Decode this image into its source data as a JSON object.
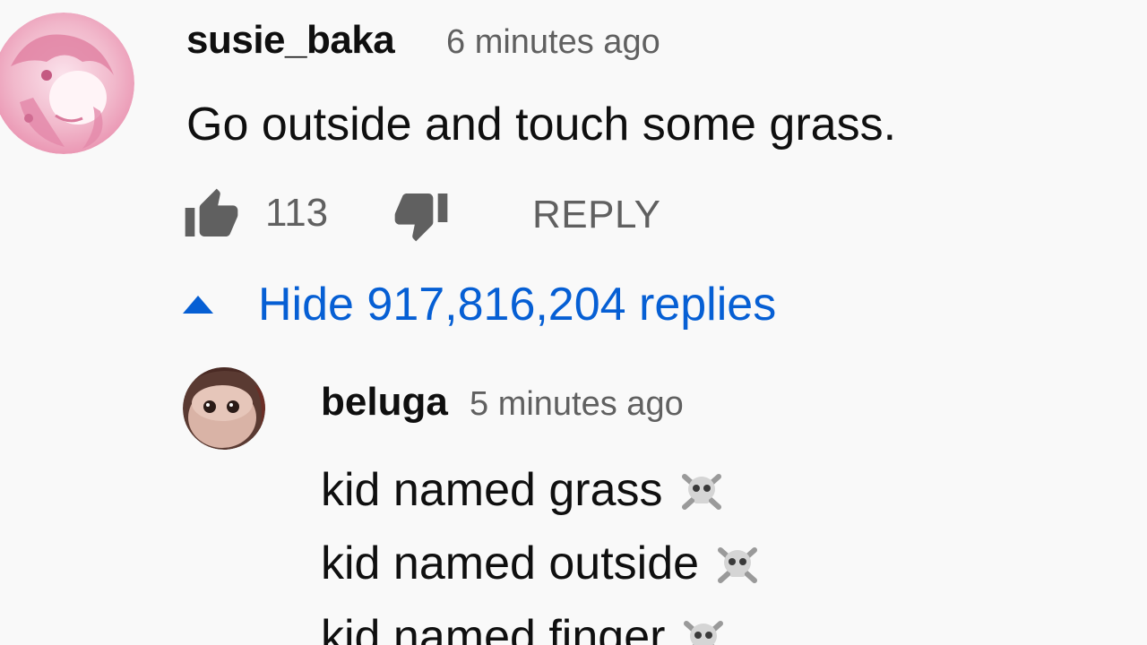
{
  "comment": {
    "author": "susie_baka",
    "time": "6 minutes ago",
    "text": "Go outside and touch some grass.",
    "likes": "113",
    "reply_label": "REPLY",
    "avatar_icon": "anime-avatar-icon",
    "like_icon": "thumb-up-icon",
    "dislike_icon": "thumb-down-icon"
  },
  "replies_toggle": {
    "label": "Hide 917,816,204 replies",
    "icon": "caret-up-icon"
  },
  "reply": {
    "author": "beluga",
    "time": "5 minutes ago",
    "avatar_icon": "beluga-avatar-icon",
    "lines": [
      {
        "text": "kid named grass",
        "emoji": "skull-crossbones-icon"
      },
      {
        "text": "kid named outside",
        "emoji": "skull-crossbones-icon"
      },
      {
        "text": "kid named finger",
        "emoji": "skull-crossbones-icon"
      }
    ]
  },
  "colors": {
    "background": "#f9f9f9",
    "primary_text": "#0f0f0f",
    "secondary_text": "#606060",
    "link_blue": "#065fd4"
  }
}
